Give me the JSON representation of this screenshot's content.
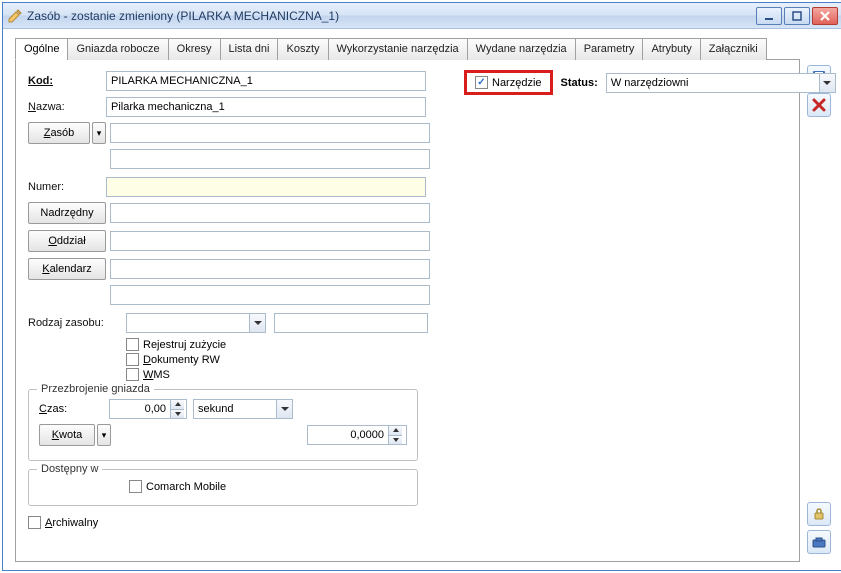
{
  "window": {
    "title": "Zasób - zostanie zmieniony  (PILARKA MECHANICZNA_1)"
  },
  "tabs": [
    "Ogólne",
    "Gniazda robocze",
    "Okresy",
    "Lista dni",
    "Koszty",
    "Wykorzystanie narzędzia",
    "Wydane narzędzia",
    "Parametry",
    "Atrybuty",
    "Załączniki"
  ],
  "labels": {
    "kod": "Kod:",
    "nazwa": "Nazwa:",
    "zasob": "Zasób",
    "numer": "Numer:",
    "nadrzedny": "Nadrzędny",
    "oddzial": "Oddział",
    "kalendarz": "Kalendarz",
    "rodzaj": "Rodzaj zasobu:",
    "rejestruj": "Rejestruj zużycie",
    "dokumenty": "Dokumenty RW",
    "wms": "WMS",
    "przezbrojenie_legend": "Przezbrojenie gniazda",
    "czas": "Czas:",
    "sekund": "sekund",
    "kwota": "Kwota",
    "dostepny_legend": "Dostępny w",
    "comarch": "Comarch Mobile",
    "archiwalny": "Archiwalny",
    "narzedzie": "Narzędzie",
    "status": "Status:"
  },
  "values": {
    "kod": "PILARKA MECHANICZNA_1",
    "nazwa": "Pilarka mechaniczna_1",
    "zasob_extra": "",
    "numer": "",
    "nadrzedny": "",
    "oddzial": "",
    "kalendarz": "",
    "kalendarz_extra": "",
    "rodzaj": "",
    "rodzaj_extra": "",
    "czas": "0,00",
    "kwota": "0,0000",
    "status": "W narzędziowni"
  },
  "checks": {
    "narzedzie": true,
    "rejestruj": false,
    "dokumenty": false,
    "wms": false,
    "comarch": false,
    "archiwalny": false
  }
}
